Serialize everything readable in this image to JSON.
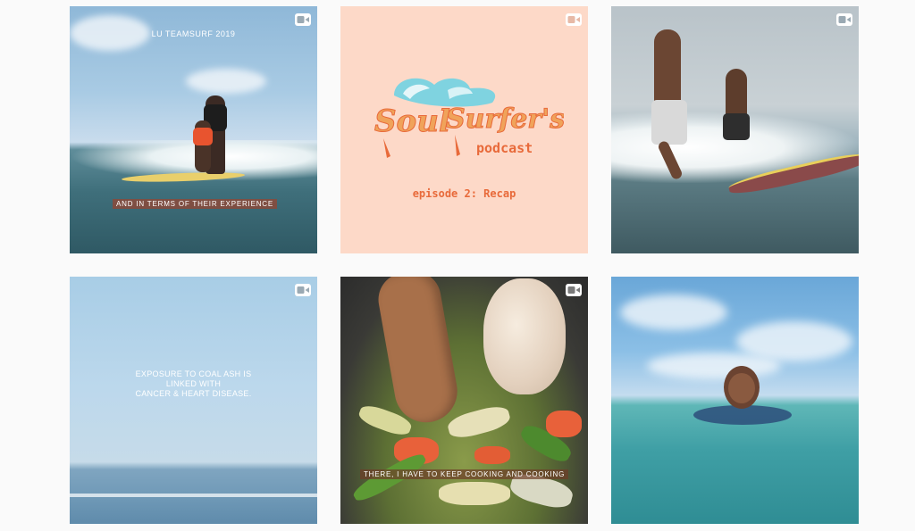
{
  "grid": {
    "tiles": [
      {
        "name": "surf-tandem-post",
        "media_type": "video",
        "overlay_top": "LU TEAMSURF 2019",
        "subtitle": "AND IN TERMS OF THEIR EXPERIENCE"
      },
      {
        "name": "podcast-post",
        "media_type": "video",
        "logo_word1": "Soul",
        "logo_word2": "Surfer's",
        "logo_word3": "podcast",
        "episode": "episode 2: Recap"
      },
      {
        "name": "surfers-post",
        "media_type": "video"
      },
      {
        "name": "coal-ash-post",
        "media_type": "video",
        "message_line1": "EXPOSURE TO COAL ASH IS",
        "message_line2": "LINKED WITH",
        "message_line3": "CANCER & HEART DISEASE."
      },
      {
        "name": "cooking-post",
        "media_type": "video",
        "subtitle": "THERE, I HAVE TO KEEP COOKING AND COOKING"
      },
      {
        "name": "swimmer-post",
        "media_type": "image"
      }
    ]
  },
  "icons": {
    "video": "video-camera-icon"
  },
  "colors": {
    "page_bg": "#fafafa",
    "podcast_bg": "#fdd9c8",
    "podcast_orange": "#e86a3a",
    "podcast_wave": "#7fd3e0"
  }
}
